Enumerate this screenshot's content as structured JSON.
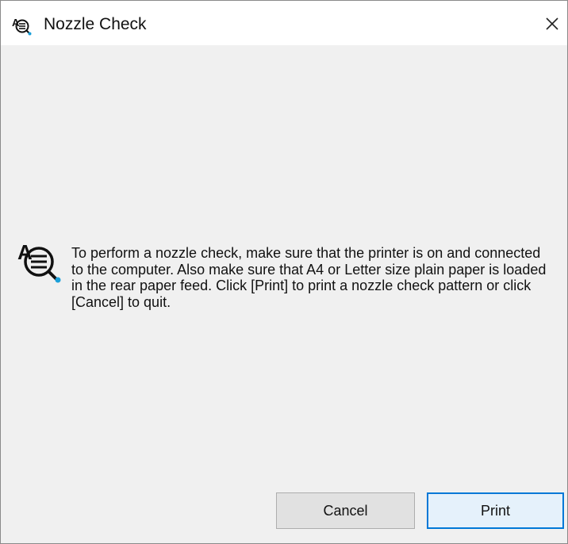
{
  "window": {
    "title": "Nozzle Check",
    "icon": "nozzle-check-icon",
    "close_glyph": "close-icon"
  },
  "message": {
    "icon": "nozzle-check-icon",
    "text": "To perform a nozzle check, make sure that the printer is on and connected to the computer. Also make sure that A4 or Letter size plain paper is loaded in the rear paper feed. Click [Print] to print a nozzle check pattern or click [Cancel] to quit."
  },
  "buttons": {
    "cancel_label": "Cancel",
    "print_label": "Print"
  },
  "colors": {
    "default_button_border": "#0078d7",
    "icon_accent": "#1a9fd9"
  }
}
